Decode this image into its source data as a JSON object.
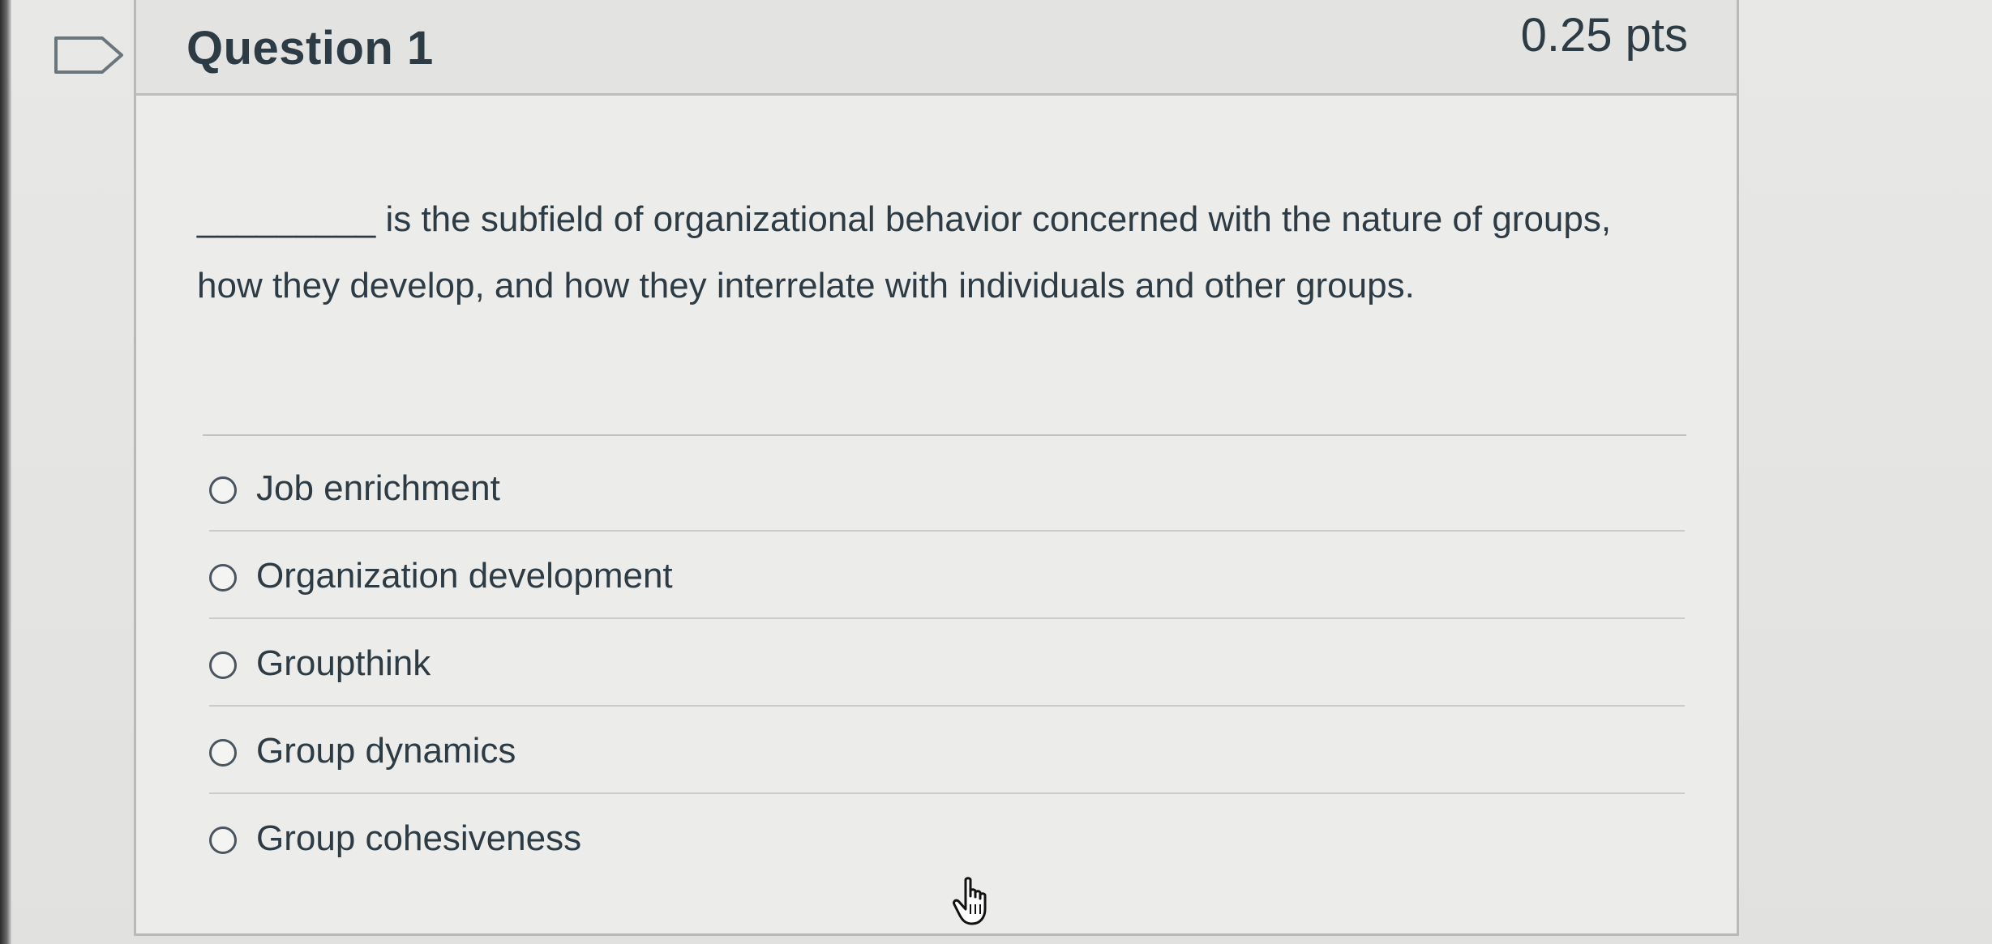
{
  "question": {
    "title": "Question 1",
    "points": "0.25 pts",
    "text": "_________ is the subfield of organizational behavior concerned with the nature of groups, how they develop, and how they interrelate with individuals and other groups."
  },
  "answers": [
    {
      "label": "Job enrichment",
      "selected": false
    },
    {
      "label": "Organization development",
      "selected": false
    },
    {
      "label": "Groupthink",
      "selected": false
    },
    {
      "label": "Group dynamics",
      "selected": false
    },
    {
      "label": "Group cohesiveness",
      "selected": false
    }
  ],
  "icons": {
    "flag": "flag-question-icon",
    "cursor": "hand-pointer-cursor-icon"
  },
  "colors": {
    "text": "#2d3b45",
    "border": "#b9b9b7",
    "header_bg": "#e3e3e1"
  }
}
